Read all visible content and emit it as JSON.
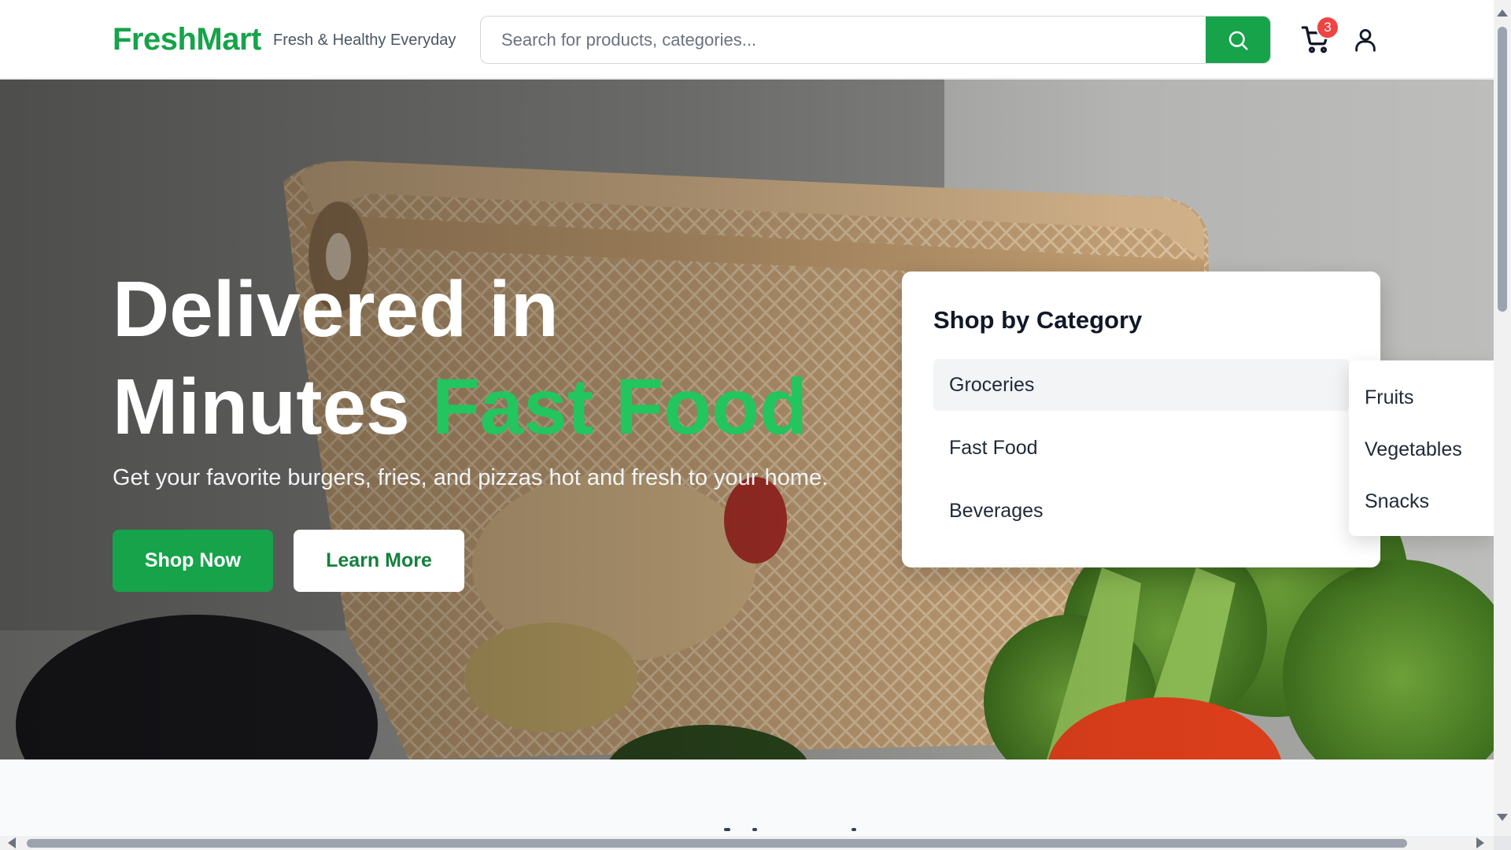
{
  "header": {
    "logo": "FreshMart",
    "tagline": "Fresh & Healthy Everyday",
    "search_placeholder": "Search for products, categories...",
    "cart_count": "3",
    "icons": {
      "search": "search-icon",
      "cart": "cart-icon",
      "user": "user-icon"
    }
  },
  "hero": {
    "title_line1": "Delivered in",
    "title_line2": "Minutes",
    "title_accent": "Fast Food",
    "subtitle": "Get your favorite burgers, fries, and pizzas hot and fresh to your home.",
    "primary_button": "Shop Now",
    "secondary_button": "Learn More"
  },
  "category_menu": {
    "title": "Shop by Category",
    "items": [
      {
        "label": "Groceries",
        "active": true
      },
      {
        "label": "Fast Food",
        "active": false
      },
      {
        "label": "Beverages",
        "active": false
      }
    ],
    "submenu": [
      "Fruits",
      "Vegetables",
      "Snacks"
    ]
  },
  "colors": {
    "brand": "#16a34a",
    "accent_text": "#22c55e",
    "badge": "#ef4444"
  }
}
